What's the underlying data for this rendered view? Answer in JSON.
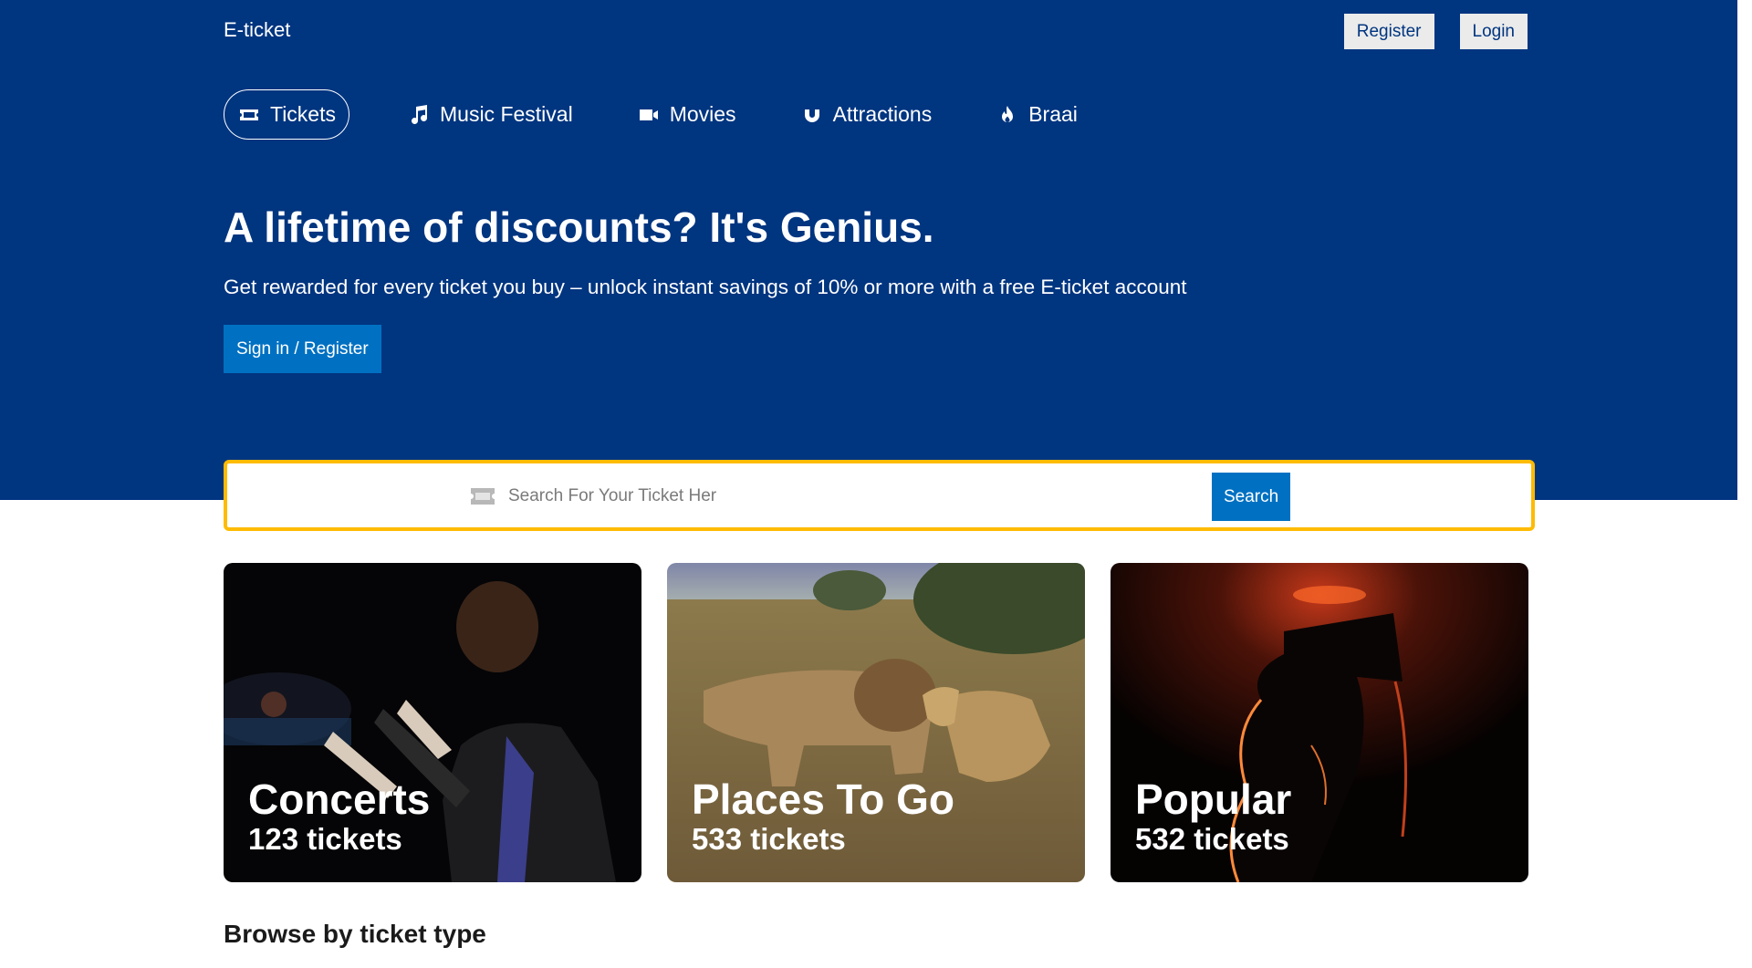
{
  "header": {
    "brand": "E-ticket",
    "register_label": "Register",
    "login_label": "Login"
  },
  "nav": {
    "tabs": [
      {
        "label": "Tickets",
        "icon": "ticket-icon",
        "active": true
      },
      {
        "label": "Music Festival",
        "icon": "music-note-icon",
        "active": false
      },
      {
        "label": "Movies",
        "icon": "video-camera-icon",
        "active": false
      },
      {
        "label": "Attractions",
        "icon": "magnet-icon",
        "active": false
      },
      {
        "label": "Braai",
        "icon": "fire-icon",
        "active": false
      }
    ]
  },
  "hero": {
    "headline": "A lifetime of discounts? It's Genius.",
    "subtext": "Get rewarded for every ticket you buy – unlock instant savings of 10% or more with a free E-ticket account",
    "cta_label": "Sign in / Register"
  },
  "search": {
    "placeholder": "Search For Your Ticket Her",
    "value": "",
    "button_label": "Search"
  },
  "cards": [
    {
      "title": "Concerts",
      "count": "123 tickets"
    },
    {
      "title": "Places To Go",
      "count": "533 tickets"
    },
    {
      "title": "Popular",
      "count": "532 tickets"
    }
  ],
  "section": {
    "title": "Browse by ticket type"
  },
  "colors": {
    "brand_blue": "#003580",
    "accent_blue": "#0071c2",
    "search_border": "#febb02"
  }
}
